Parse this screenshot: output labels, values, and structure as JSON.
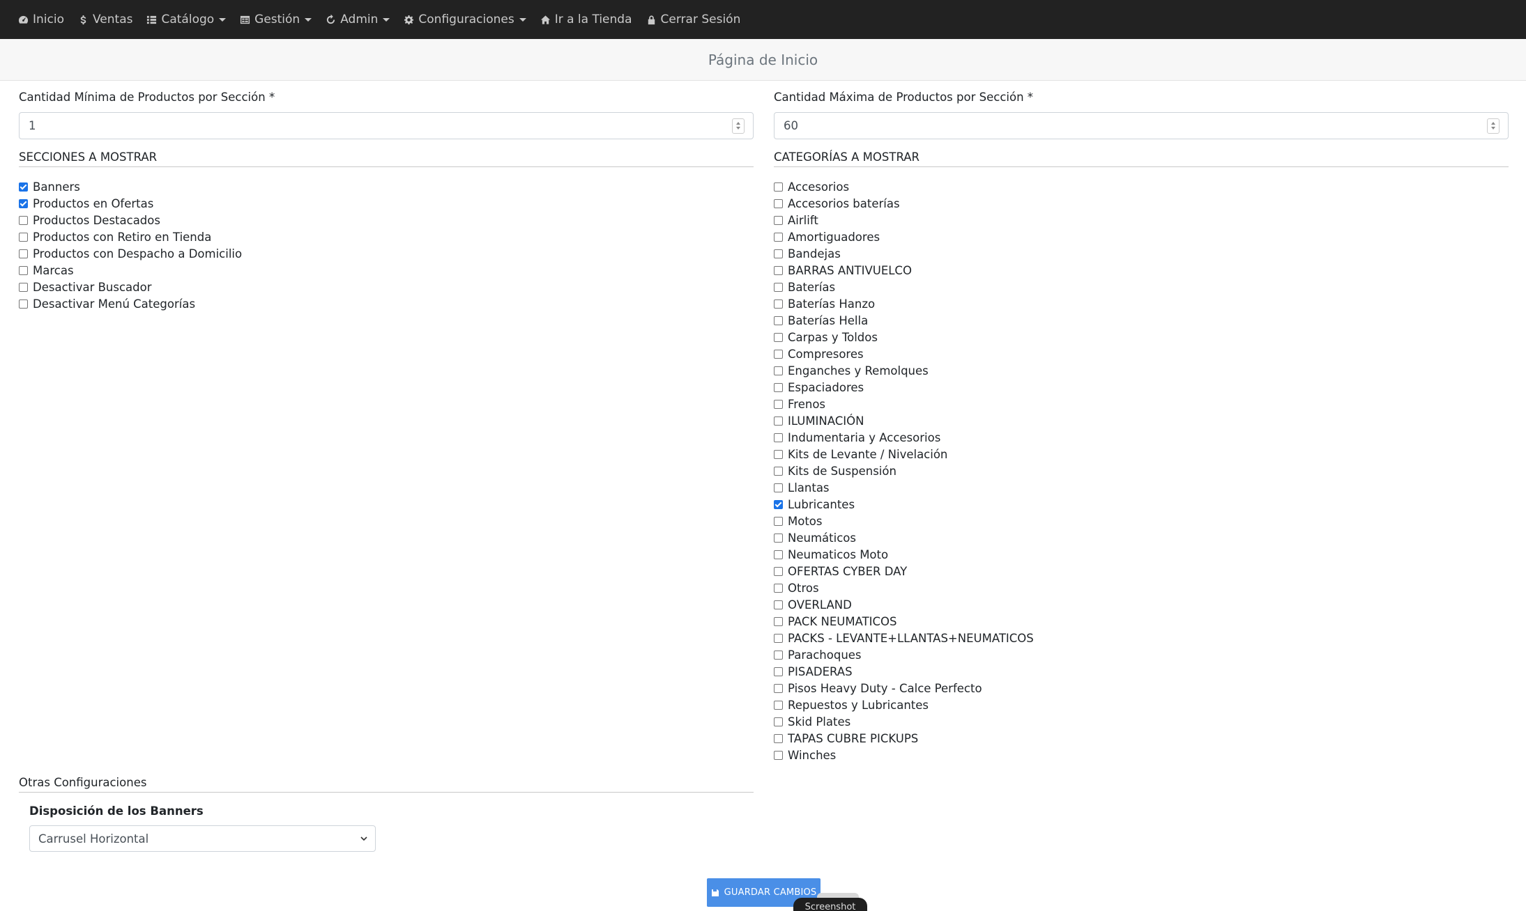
{
  "navbar": {
    "items": [
      {
        "label": "Inicio",
        "icon": "dashboard-icon",
        "dropdown": false
      },
      {
        "label": "Ventas",
        "icon": "dollar-icon",
        "dropdown": false
      },
      {
        "label": "Catálogo",
        "icon": "list-icon",
        "dropdown": true
      },
      {
        "label": "Gestión",
        "icon": "table-icon",
        "dropdown": true
      },
      {
        "label": "Admin",
        "icon": "sync-icon",
        "dropdown": true
      },
      {
        "label": "Configuraciones",
        "icon": "gear-icon",
        "dropdown": true
      },
      {
        "label": "Ir a la Tienda",
        "icon": "home-icon",
        "dropdown": false
      },
      {
        "label": "Cerrar Sesión",
        "icon": "lock-icon",
        "dropdown": false
      }
    ]
  },
  "header": {
    "title": "Página de Inicio"
  },
  "min_products": {
    "label": "Cantidad Mínima de Productos por Sección *",
    "value": "1"
  },
  "max_products": {
    "label": "Cantidad Máxima de Productos por Sección *",
    "value": "60"
  },
  "sections": {
    "title": "SECCIONES A MOSTRAR",
    "items": [
      {
        "label": "Banners",
        "checked": true
      },
      {
        "label": "Productos en Ofertas",
        "checked": true
      },
      {
        "label": "Productos Destacados",
        "checked": false
      },
      {
        "label": "Productos con Retiro en Tienda",
        "checked": false
      },
      {
        "label": "Productos con Despacho a Domicilio",
        "checked": false
      },
      {
        "label": "Marcas",
        "checked": false
      },
      {
        "label": "Desactivar Buscador",
        "checked": false
      },
      {
        "label": "Desactivar Menú Categorías",
        "checked": false
      }
    ]
  },
  "categories": {
    "title": "CATEGORÍAS A MOSTRAR",
    "items": [
      {
        "label": "Accesorios",
        "checked": false
      },
      {
        "label": "Accesorios baterías",
        "checked": false
      },
      {
        "label": "Airlift",
        "checked": false
      },
      {
        "label": "Amortiguadores",
        "checked": false
      },
      {
        "label": "Bandejas",
        "checked": false
      },
      {
        "label": "BARRAS ANTIVUELCO",
        "checked": false
      },
      {
        "label": "Baterías",
        "checked": false
      },
      {
        "label": "Baterías Hanzo",
        "checked": false
      },
      {
        "label": "Baterías Hella",
        "checked": false
      },
      {
        "label": "Carpas y Toldos",
        "checked": false
      },
      {
        "label": "Compresores",
        "checked": false
      },
      {
        "label": "Enganches y Remolques",
        "checked": false
      },
      {
        "label": "Espaciadores",
        "checked": false
      },
      {
        "label": "Frenos",
        "checked": false
      },
      {
        "label": "ILUMINACIÓN",
        "checked": false
      },
      {
        "label": "Indumentaria y Accesorios",
        "checked": false
      },
      {
        "label": "Kits de Levante / Nivelación",
        "checked": false
      },
      {
        "label": "Kits de Suspensión",
        "checked": false
      },
      {
        "label": "Llantas",
        "checked": false
      },
      {
        "label": "Lubricantes",
        "checked": true
      },
      {
        "label": "Motos",
        "checked": false
      },
      {
        "label": "Neumáticos",
        "checked": false
      },
      {
        "label": "Neumaticos Moto",
        "checked": false
      },
      {
        "label": "OFERTAS CYBER DAY",
        "checked": false
      },
      {
        "label": "Otros",
        "checked": false
      },
      {
        "label": "OVERLAND",
        "checked": false
      },
      {
        "label": "PACK NEUMATICOS",
        "checked": false
      },
      {
        "label": "PACKS - LEVANTE+LLANTAS+NEUMATICOS",
        "checked": false
      },
      {
        "label": "Parachoques",
        "checked": false
      },
      {
        "label": "PISADERAS",
        "checked": false
      },
      {
        "label": "Pisos Heavy Duty - Calce Perfecto",
        "checked": false
      },
      {
        "label": "Repuestos y Lubricantes",
        "checked": false
      },
      {
        "label": "Skid Plates",
        "checked": false
      },
      {
        "label": "TAPAS CUBRE PICKUPS",
        "checked": false
      },
      {
        "label": "Winches",
        "checked": false
      }
    ]
  },
  "other": {
    "title": "Otras Configuraciones",
    "banner_label": "Disposición de los Banners",
    "banner_value": "Carrusel Horizontal"
  },
  "save": {
    "label": "GUARDAR CAMBIOS"
  },
  "toast": {
    "label": "Screenshot"
  },
  "colors": {
    "navbar": "#222222",
    "accent": "#1a73e8",
    "save_button": "#4a8fe7"
  }
}
